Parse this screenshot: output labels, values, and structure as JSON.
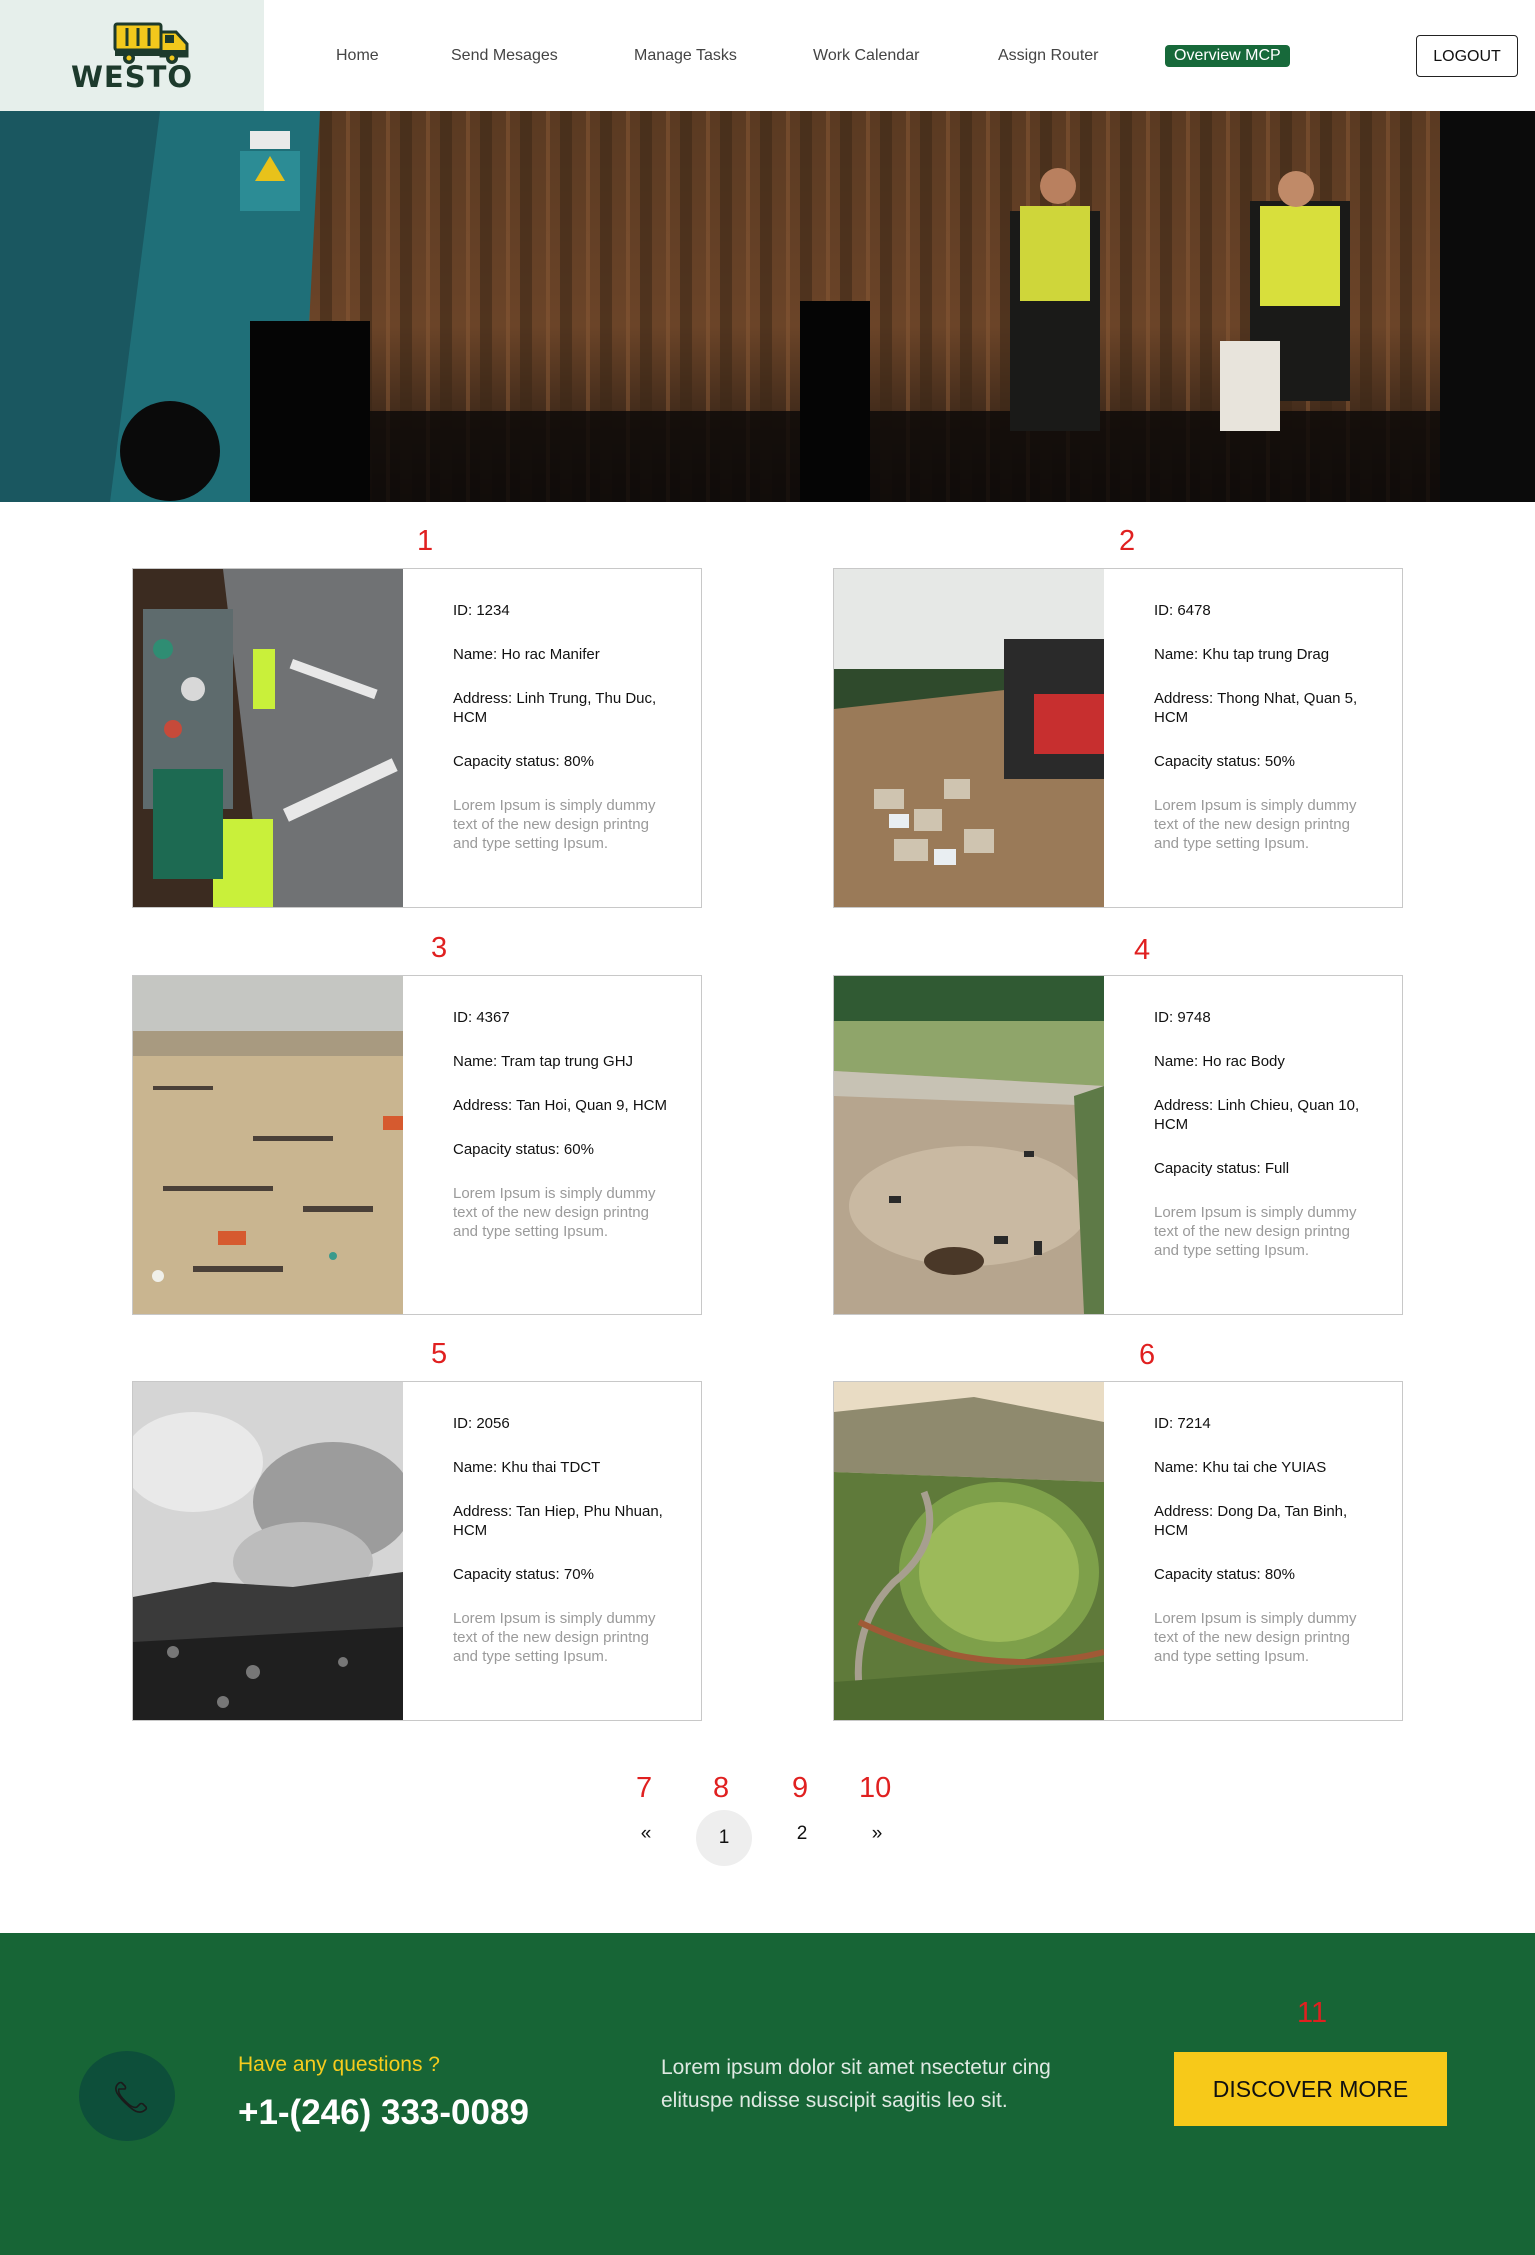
{
  "brand": {
    "name": "WESTO"
  },
  "nav": {
    "items": [
      {
        "label": "Home"
      },
      {
        "label": "Send Mesages"
      },
      {
        "label": "Manage Tasks"
      },
      {
        "label": "Work Calendar"
      },
      {
        "label": "Assign Router"
      },
      {
        "label": "Overview MCP",
        "active": true
      }
    ],
    "logout_label": "LOGOUT"
  },
  "colors": {
    "brand_green": "#17693a",
    "footer_green": "#176536",
    "accent_yellow": "#f7c919",
    "annotation_red": "#e02020"
  },
  "annotations": [
    "1",
    "2",
    "3",
    "4",
    "5",
    "6",
    "7",
    "8",
    "9",
    "10",
    "11"
  ],
  "cards": [
    {
      "id": "ID: 1234",
      "name": "Name: Ho rac Manifer",
      "address": "Address: Linh Trung, Thu Duc, HCM",
      "capacity": "Capacity status: 80%",
      "description": "Lorem Ipsum is simply dummy text of the new design printng and type setting Ipsum."
    },
    {
      "id": "ID: 6478",
      "name": "Name: Khu tap trung Drag",
      "address": "Address: Thong Nhat, Quan 5, HCM",
      "capacity": "Capacity status: 50%",
      "description": "Lorem Ipsum is simply dummy text of the new design printng and type setting Ipsum."
    },
    {
      "id": "ID: 4367",
      "name": "Name: Tram tap trung GHJ",
      "address": "Address: Tan Hoi, Quan 9, HCM",
      "capacity": "Capacity status: 60%",
      "description": "Lorem Ipsum is simply dummy text of the new design printng and type setting Ipsum."
    },
    {
      "id": "ID: 9748",
      "name": "Name: Ho rac Body",
      "address": "Address: Linh Chieu, Quan 10, HCM",
      "capacity": "Capacity status: Full",
      "description": "Lorem Ipsum is simply dummy text of the new design printng and type setting Ipsum."
    },
    {
      "id": "ID: 2056",
      "name": "Name: Khu thai TDCT",
      "address": "Address: Tan Hiep, Phu Nhuan, HCM",
      "capacity": "Capacity status: 70%",
      "description": "Lorem Ipsum is simply dummy text of the new design printng and type setting Ipsum."
    },
    {
      "id": "ID: 7214",
      "name": "Name: Khu tai che YUIAS",
      "address": "Address: Dong Da, Tan Binh, HCM",
      "capacity": "Capacity status: 80%",
      "description": "Lorem Ipsum is simply dummy text of the new design printng and type setting Ipsum."
    }
  ],
  "pagination": {
    "prev": "«",
    "pages": [
      "1",
      "2"
    ],
    "next": "»",
    "current": "1"
  },
  "footer": {
    "question": "Have any questions ?",
    "phone": "+1-(246) 333-0089",
    "lorem": "Lorem ipsum dolor sit amet nsectetur cing elituspe ndisse suscipit sagitis leo sit.",
    "cta_label": "DISCOVER MORE",
    "phone_icon": "phone-icon"
  }
}
